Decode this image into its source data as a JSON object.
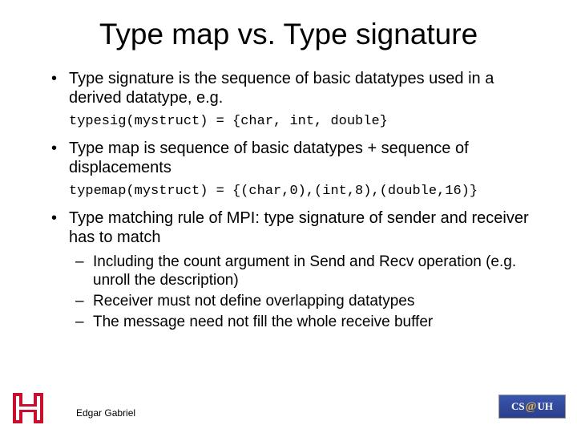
{
  "title": "Type map vs. Type signature",
  "bullets": {
    "b1": "Type signature is the sequence of basic datatypes used in a derived datatype, e.g.",
    "code1": "typesig(mystruct) = {char, int, double}",
    "b2": "Type map is sequence of basic datatypes + sequence of displacements",
    "code2": "typemap(mystruct) = {(char,0),(int,8),(double,16)}",
    "b3": "Type matching rule of MPI: type signature of sender and receiver has to match",
    "sub1": "Including the count argument in Send and Recv operation (e.g. unroll the description)",
    "sub2": "Receiver must not define overlapping datatypes",
    "sub3": "The message need not fill the whole receive buffer"
  },
  "footer": {
    "author": "Edgar Gabriel",
    "logo_left": "UH",
    "logo_right_cs": "CS",
    "logo_right_uh": "UH"
  }
}
